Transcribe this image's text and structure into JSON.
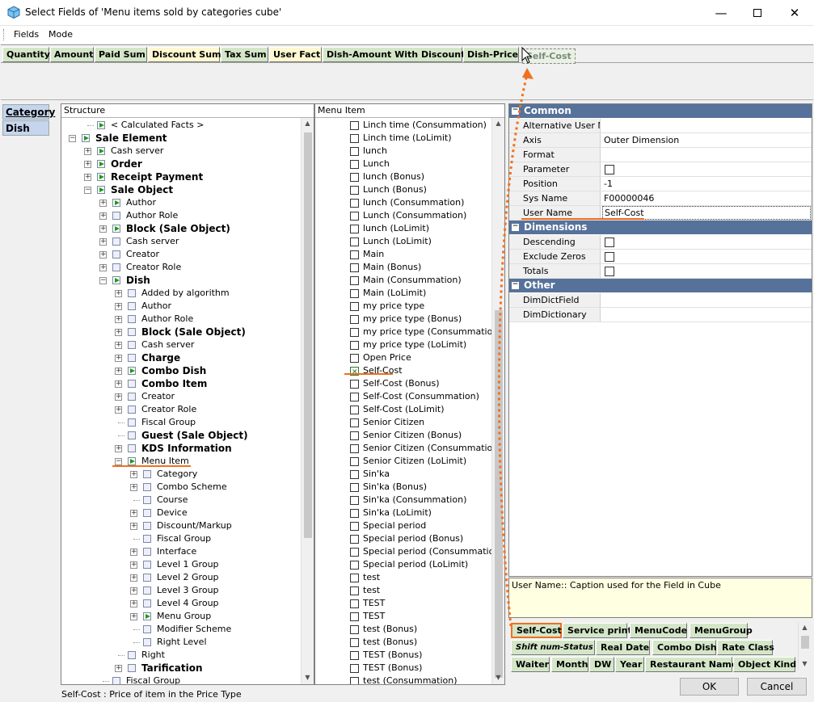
{
  "window": {
    "title": "Select Fields of 'Menu items sold by categories cube'"
  },
  "menubar": {
    "items": [
      "Fields",
      "Mode"
    ]
  },
  "facts": [
    {
      "label": "Quantity",
      "bg": "#d4e6c8"
    },
    {
      "label": "Amount",
      "bg": "#d4e6c8"
    },
    {
      "label": "Paid Sum",
      "bg": "#d4e6c8"
    },
    {
      "label": "Discount Sum",
      "bg": "#fff8d0"
    },
    {
      "label": "Tax Sum",
      "bg": "#d4e6c8"
    },
    {
      "label": "User Fact",
      "bg": "#fff8d0"
    },
    {
      "label": "Dish-Amount With Discounts",
      "bg": "#d4e6c8"
    },
    {
      "label": "Dish-Price",
      "bg": "#d4e6c8"
    }
  ],
  "dragging_label": "Self-Cost",
  "left_tabs": [
    "Category",
    "Dish"
  ],
  "structure": {
    "header": "Structure",
    "status": "Self-Cost : Price of item in the Price Type",
    "nodes": [
      {
        "label": "< Calculated Facts >",
        "level": 1,
        "bold": false,
        "icon": "green",
        "exp": "dot"
      },
      {
        "label": "Sale Element",
        "level": 0,
        "bold": true,
        "icon": "green",
        "exp": "-"
      },
      {
        "label": "Cash server",
        "level": 1,
        "bold": false,
        "icon": "green",
        "exp": "+"
      },
      {
        "label": "Order",
        "level": 1,
        "bold": true,
        "icon": "green",
        "exp": "+"
      },
      {
        "label": "Receipt Payment",
        "level": 1,
        "bold": true,
        "icon": "green",
        "exp": "+"
      },
      {
        "label": "Sale Object",
        "level": 1,
        "bold": true,
        "icon": "green",
        "exp": "-"
      },
      {
        "label": "Author",
        "level": 2,
        "bold": false,
        "icon": "green",
        "exp": "+"
      },
      {
        "label": "Author Role",
        "level": 2,
        "bold": false,
        "icon": "plain",
        "exp": "+"
      },
      {
        "label": "Block (Sale Object)",
        "level": 2,
        "bold": true,
        "icon": "green",
        "exp": "+"
      },
      {
        "label": "Cash server",
        "level": 2,
        "bold": false,
        "icon": "plain",
        "exp": "+"
      },
      {
        "label": "Creator",
        "level": 2,
        "bold": false,
        "icon": "plain",
        "exp": "+"
      },
      {
        "label": "Creator Role",
        "level": 2,
        "bold": false,
        "icon": "plain",
        "exp": "+"
      },
      {
        "label": "Dish",
        "level": 2,
        "bold": true,
        "icon": "green",
        "exp": "-"
      },
      {
        "label": "Added by algorithm",
        "level": 3,
        "bold": false,
        "icon": "plain",
        "exp": "+"
      },
      {
        "label": "Author",
        "level": 3,
        "bold": false,
        "icon": "plain",
        "exp": "+"
      },
      {
        "label": "Author Role",
        "level": 3,
        "bold": false,
        "icon": "plain",
        "exp": "+"
      },
      {
        "label": "Block (Sale Object)",
        "level": 3,
        "bold": true,
        "icon": "plain",
        "exp": "+"
      },
      {
        "label": "Cash server",
        "level": 3,
        "bold": false,
        "icon": "plain",
        "exp": "+"
      },
      {
        "label": "Charge",
        "level": 3,
        "bold": true,
        "icon": "plain",
        "exp": "+"
      },
      {
        "label": "Combo Dish",
        "level": 3,
        "bold": true,
        "icon": "green",
        "exp": "+"
      },
      {
        "label": "Combo Item",
        "level": 3,
        "bold": true,
        "icon": "plain",
        "exp": "+"
      },
      {
        "label": "Creator",
        "level": 3,
        "bold": false,
        "icon": "plain",
        "exp": "+"
      },
      {
        "label": "Creator Role",
        "level": 3,
        "bold": false,
        "icon": "plain",
        "exp": "+"
      },
      {
        "label": "Fiscal Group",
        "level": 3,
        "bold": false,
        "icon": "plain",
        "exp": "dot"
      },
      {
        "label": "Guest (Sale Object)",
        "level": 3,
        "bold": true,
        "icon": "plain",
        "exp": "dot"
      },
      {
        "label": "KDS Information",
        "level": 3,
        "bold": true,
        "icon": "plain",
        "exp": "+"
      },
      {
        "label": "Menu Item",
        "level": 3,
        "bold": false,
        "icon": "green",
        "exp": "-"
      },
      {
        "label": "Category",
        "level": 4,
        "bold": false,
        "icon": "plain",
        "exp": "+"
      },
      {
        "label": "Combo Scheme",
        "level": 4,
        "bold": false,
        "icon": "plain",
        "exp": "+"
      },
      {
        "label": "Course",
        "level": 4,
        "bold": false,
        "icon": "plain",
        "exp": "dot"
      },
      {
        "label": "Device",
        "level": 4,
        "bold": false,
        "icon": "plain",
        "exp": "+"
      },
      {
        "label": "Discount/Markup",
        "level": 4,
        "bold": false,
        "icon": "plain",
        "exp": "+"
      },
      {
        "label": "Fiscal Group",
        "level": 4,
        "bold": false,
        "icon": "plain",
        "exp": "dot"
      },
      {
        "label": "Interface",
        "level": 4,
        "bold": false,
        "icon": "plain",
        "exp": "+"
      },
      {
        "label": "Level 1 Group",
        "level": 4,
        "bold": false,
        "icon": "plain",
        "exp": "+"
      },
      {
        "label": "Level 2 Group",
        "level": 4,
        "bold": false,
        "icon": "plain",
        "exp": "+"
      },
      {
        "label": "Level 3 Group",
        "level": 4,
        "bold": false,
        "icon": "plain",
        "exp": "+"
      },
      {
        "label": "Level 4 Group",
        "level": 4,
        "bold": false,
        "icon": "plain",
        "exp": "+"
      },
      {
        "label": "Menu Group",
        "level": 4,
        "bold": false,
        "icon": "green",
        "exp": "+"
      },
      {
        "label": "Modifier Scheme",
        "level": 4,
        "bold": false,
        "icon": "plain",
        "exp": "dot"
      },
      {
        "label": "Right Level",
        "level": 4,
        "bold": false,
        "icon": "plain",
        "exp": "dot"
      },
      {
        "label": "Right",
        "level": 3,
        "bold": false,
        "icon": "plain",
        "exp": "dot"
      },
      {
        "label": "Tarification",
        "level": 3,
        "bold": true,
        "icon": "plain",
        "exp": "+"
      },
      {
        "label": "Fiscal Group",
        "level": 2,
        "bold": false,
        "icon": "plain",
        "exp": "dot"
      }
    ]
  },
  "menu_item": {
    "header": "Menu Item",
    "items": [
      {
        "label": "Linch time (Consummation)",
        "checked": false
      },
      {
        "label": "Linch time (LoLimit)",
        "checked": false
      },
      {
        "label": "lunch",
        "checked": false
      },
      {
        "label": "Lunch",
        "checked": false
      },
      {
        "label": "lunch (Bonus)",
        "checked": false
      },
      {
        "label": "Lunch (Bonus)",
        "checked": false
      },
      {
        "label": "lunch (Consummation)",
        "checked": false
      },
      {
        "label": "Lunch (Consummation)",
        "checked": false
      },
      {
        "label": "lunch (LoLimit)",
        "checked": false
      },
      {
        "label": "Lunch (LoLimit)",
        "checked": false
      },
      {
        "label": "Main",
        "checked": false
      },
      {
        "label": "Main (Bonus)",
        "checked": false
      },
      {
        "label": "Main (Consummation)",
        "checked": false
      },
      {
        "label": "Main (LoLimit)",
        "checked": false
      },
      {
        "label": "my price type",
        "checked": false
      },
      {
        "label": "my price type (Bonus)",
        "checked": false
      },
      {
        "label": "my price type (Consummation)",
        "checked": false
      },
      {
        "label": "my price type (LoLimit)",
        "checked": false
      },
      {
        "label": "Open Price",
        "checked": false
      },
      {
        "label": "Self-Cost",
        "checked": true
      },
      {
        "label": "Self-Cost (Bonus)",
        "checked": false
      },
      {
        "label": "Self-Cost (Consummation)",
        "checked": false
      },
      {
        "label": "Self-Cost (LoLimit)",
        "checked": false
      },
      {
        "label": "Senior Citizen",
        "checked": false
      },
      {
        "label": "Senior Citizen (Bonus)",
        "checked": false
      },
      {
        "label": "Senior Citizen (Consummation)",
        "checked": false
      },
      {
        "label": "Senior Citizen (LoLimit)",
        "checked": false
      },
      {
        "label": "Sin'ka",
        "checked": false
      },
      {
        "label": "Sin'ka (Bonus)",
        "checked": false
      },
      {
        "label": "Sin'ka (Consummation)",
        "checked": false
      },
      {
        "label": "Sin'ka (LoLimit)",
        "checked": false
      },
      {
        "label": "Special period",
        "checked": false
      },
      {
        "label": "Special period (Bonus)",
        "checked": false
      },
      {
        "label": "Special period (Consummation)",
        "checked": false
      },
      {
        "label": "Special period (LoLimit)",
        "checked": false
      },
      {
        "label": "test",
        "checked": false
      },
      {
        "label": "test",
        "checked": false
      },
      {
        "label": "TEST",
        "checked": false
      },
      {
        "label": "TEST",
        "checked": false
      },
      {
        "label": "test (Bonus)",
        "checked": false
      },
      {
        "label": "test (Bonus)",
        "checked": false
      },
      {
        "label": "TEST (Bonus)",
        "checked": false
      },
      {
        "label": "TEST (Bonus)",
        "checked": false
      },
      {
        "label": "test (Consummation)",
        "checked": false
      }
    ]
  },
  "properties": {
    "categories": [
      {
        "name": "Common",
        "rows": [
          {
            "name": "Alternative User Na",
            "value": "",
            "checkbox": false
          },
          {
            "name": "Axis",
            "value": "Outer Dimension",
            "checkbox": false
          },
          {
            "name": "Format",
            "value": "",
            "checkbox": false
          },
          {
            "name": "Parameter",
            "value": "",
            "checkbox": true
          },
          {
            "name": "Position",
            "value": "-1",
            "checkbox": false
          },
          {
            "name": "Sys Name",
            "value": "F00000046",
            "checkbox": false
          },
          {
            "name": "User Name",
            "value": "Self-Cost",
            "checkbox": false,
            "selected": true
          }
        ]
      },
      {
        "name": "Dimensions",
        "rows": [
          {
            "name": "Descending",
            "value": "",
            "checkbox": true
          },
          {
            "name": "Exclude Zeros",
            "value": "",
            "checkbox": true
          },
          {
            "name": "Totals",
            "value": "",
            "checkbox": true
          }
        ]
      },
      {
        "name": "Other",
        "rows": [
          {
            "name": "DimDictField",
            "value": "",
            "checkbox": false
          },
          {
            "name": "DimDictionary",
            "value": "",
            "checkbox": false
          }
        ]
      }
    ],
    "description": "User Name:: Caption used for the Field in Cube"
  },
  "field_tags": {
    "rows": [
      [
        "Self-Cost",
        "Service print",
        "MenuCode",
        "MenuGroup"
      ],
      [
        "Shift num-Status",
        "Real Date",
        "Combo Dish",
        "Rate Class"
      ],
      [
        "Waiter",
        "Month",
        "DW",
        "Year",
        "Restaurant Name",
        "Object Kind"
      ]
    ]
  },
  "buttons": {
    "ok": "OK",
    "cancel": "Cancel"
  },
  "colors": {
    "accent_orange": "#f07020",
    "category_bar": "#56729a",
    "description_bg": "#ffffe1",
    "fact_green": "#d4e6c8"
  }
}
